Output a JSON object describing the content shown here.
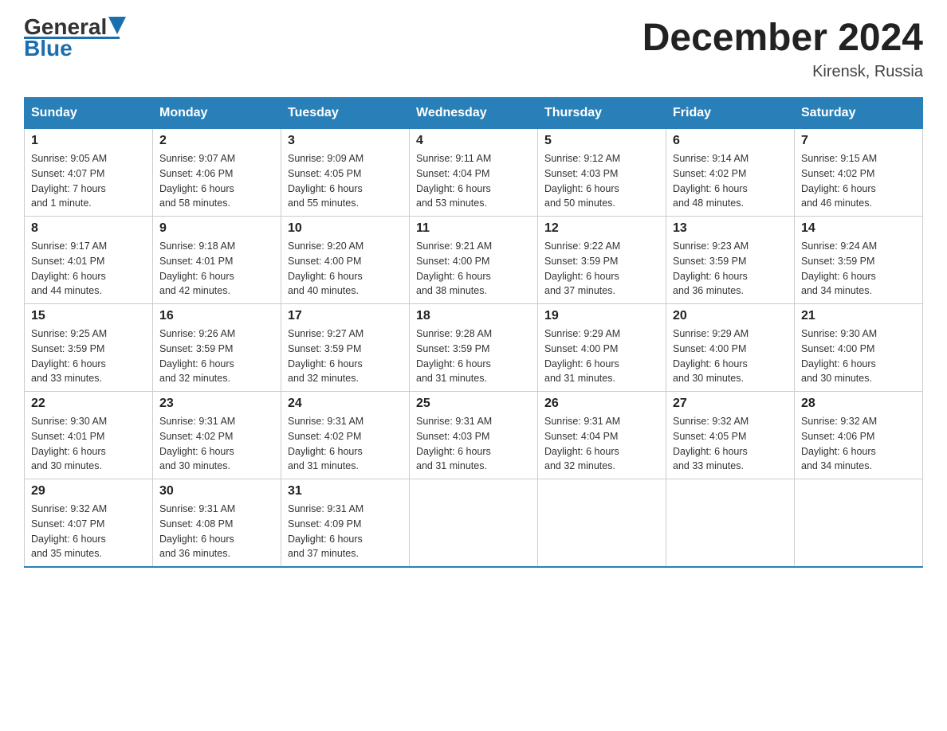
{
  "header": {
    "logo_general": "General",
    "logo_blue": "Blue",
    "month_title": "December 2024",
    "location": "Kirensk, Russia"
  },
  "days_of_week": [
    "Sunday",
    "Monday",
    "Tuesday",
    "Wednesday",
    "Thursday",
    "Friday",
    "Saturday"
  ],
  "weeks": [
    [
      {
        "day": 1,
        "sunrise": "9:05 AM",
        "sunset": "4:07 PM",
        "daylight": "7 hours and 1 minute."
      },
      {
        "day": 2,
        "sunrise": "9:07 AM",
        "sunset": "4:06 PM",
        "daylight": "6 hours and 58 minutes."
      },
      {
        "day": 3,
        "sunrise": "9:09 AM",
        "sunset": "4:05 PM",
        "daylight": "6 hours and 55 minutes."
      },
      {
        "day": 4,
        "sunrise": "9:11 AM",
        "sunset": "4:04 PM",
        "daylight": "6 hours and 53 minutes."
      },
      {
        "day": 5,
        "sunrise": "9:12 AM",
        "sunset": "4:03 PM",
        "daylight": "6 hours and 50 minutes."
      },
      {
        "day": 6,
        "sunrise": "9:14 AM",
        "sunset": "4:02 PM",
        "daylight": "6 hours and 48 minutes."
      },
      {
        "day": 7,
        "sunrise": "9:15 AM",
        "sunset": "4:02 PM",
        "daylight": "6 hours and 46 minutes."
      }
    ],
    [
      {
        "day": 8,
        "sunrise": "9:17 AM",
        "sunset": "4:01 PM",
        "daylight": "6 hours and 44 minutes."
      },
      {
        "day": 9,
        "sunrise": "9:18 AM",
        "sunset": "4:01 PM",
        "daylight": "6 hours and 42 minutes."
      },
      {
        "day": 10,
        "sunrise": "9:20 AM",
        "sunset": "4:00 PM",
        "daylight": "6 hours and 40 minutes."
      },
      {
        "day": 11,
        "sunrise": "9:21 AM",
        "sunset": "4:00 PM",
        "daylight": "6 hours and 38 minutes."
      },
      {
        "day": 12,
        "sunrise": "9:22 AM",
        "sunset": "3:59 PM",
        "daylight": "6 hours and 37 minutes."
      },
      {
        "day": 13,
        "sunrise": "9:23 AM",
        "sunset": "3:59 PM",
        "daylight": "6 hours and 36 minutes."
      },
      {
        "day": 14,
        "sunrise": "9:24 AM",
        "sunset": "3:59 PM",
        "daylight": "6 hours and 34 minutes."
      }
    ],
    [
      {
        "day": 15,
        "sunrise": "9:25 AM",
        "sunset": "3:59 PM",
        "daylight": "6 hours and 33 minutes."
      },
      {
        "day": 16,
        "sunrise": "9:26 AM",
        "sunset": "3:59 PM",
        "daylight": "6 hours and 32 minutes."
      },
      {
        "day": 17,
        "sunrise": "9:27 AM",
        "sunset": "3:59 PM",
        "daylight": "6 hours and 32 minutes."
      },
      {
        "day": 18,
        "sunrise": "9:28 AM",
        "sunset": "3:59 PM",
        "daylight": "6 hours and 31 minutes."
      },
      {
        "day": 19,
        "sunrise": "9:29 AM",
        "sunset": "4:00 PM",
        "daylight": "6 hours and 31 minutes."
      },
      {
        "day": 20,
        "sunrise": "9:29 AM",
        "sunset": "4:00 PM",
        "daylight": "6 hours and 30 minutes."
      },
      {
        "day": 21,
        "sunrise": "9:30 AM",
        "sunset": "4:00 PM",
        "daylight": "6 hours and 30 minutes."
      }
    ],
    [
      {
        "day": 22,
        "sunrise": "9:30 AM",
        "sunset": "4:01 PM",
        "daylight": "6 hours and 30 minutes."
      },
      {
        "day": 23,
        "sunrise": "9:31 AM",
        "sunset": "4:02 PM",
        "daylight": "6 hours and 30 minutes."
      },
      {
        "day": 24,
        "sunrise": "9:31 AM",
        "sunset": "4:02 PM",
        "daylight": "6 hours and 31 minutes."
      },
      {
        "day": 25,
        "sunrise": "9:31 AM",
        "sunset": "4:03 PM",
        "daylight": "6 hours and 31 minutes."
      },
      {
        "day": 26,
        "sunrise": "9:31 AM",
        "sunset": "4:04 PM",
        "daylight": "6 hours and 32 minutes."
      },
      {
        "day": 27,
        "sunrise": "9:32 AM",
        "sunset": "4:05 PM",
        "daylight": "6 hours and 33 minutes."
      },
      {
        "day": 28,
        "sunrise": "9:32 AM",
        "sunset": "4:06 PM",
        "daylight": "6 hours and 34 minutes."
      }
    ],
    [
      {
        "day": 29,
        "sunrise": "9:32 AM",
        "sunset": "4:07 PM",
        "daylight": "6 hours and 35 minutes."
      },
      {
        "day": 30,
        "sunrise": "9:31 AM",
        "sunset": "4:08 PM",
        "daylight": "6 hours and 36 minutes."
      },
      {
        "day": 31,
        "sunrise": "9:31 AM",
        "sunset": "4:09 PM",
        "daylight": "6 hours and 37 minutes."
      },
      null,
      null,
      null,
      null
    ]
  ],
  "labels": {
    "sunrise": "Sunrise:",
    "sunset": "Sunset:",
    "daylight": "Daylight:"
  }
}
